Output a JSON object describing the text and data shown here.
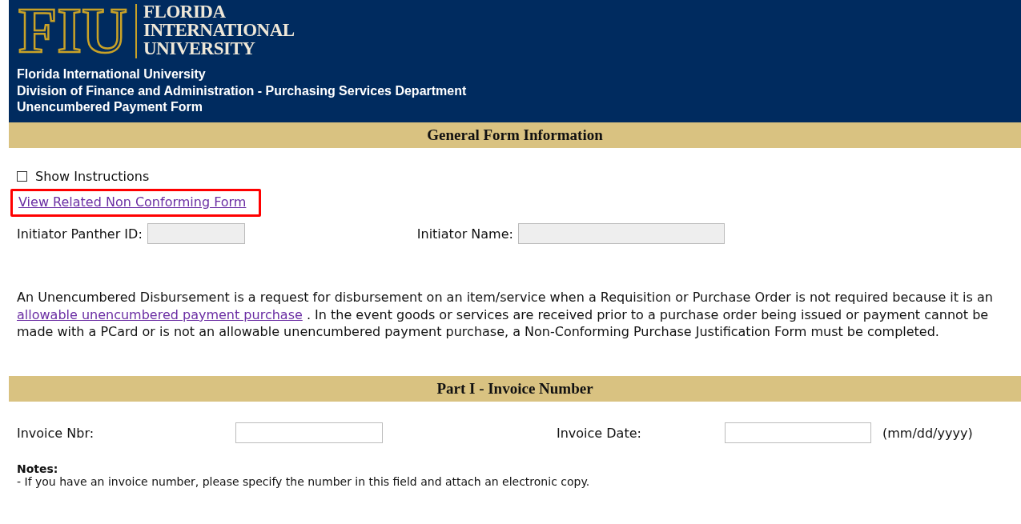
{
  "header": {
    "logo_letters": "FIU",
    "logo_name": [
      "FLORIDA",
      "INTERNATIONAL",
      "UNIVERSITY"
    ],
    "lines": [
      "Florida International University",
      "Division of Finance and Administration - Purchasing Services Department",
      "Unencumbered Payment Form"
    ]
  },
  "sections": [
    {
      "title": "General Form Information"
    },
    {
      "title": "Part I - Invoice Number"
    }
  ],
  "show_instructions": {
    "label": "Show Instructions",
    "checked": false
  },
  "related_link": {
    "label": "View Related Non Conforming Form",
    "highlighted": true
  },
  "initiator": [
    {
      "label": "Initiator Panther ID:",
      "disabled": true
    },
    {
      "label": "Initiator Name:",
      "disabled": true
    }
  ],
  "description": {
    "before": "An Unencumbered Disbursement is a request for disbursement on an item/service when a Requisition or Purchase Order is not required because it is an",
    "link": "allowable unencumbered payment purchase",
    "after": ". In the event goods or services are received prior to a purchase order being issued or payment cannot be made with a PCard or is not an allowable unencumbered payment purchase, a Non-Conforming Purchase Justification Form must be completed."
  },
  "invoice": [
    {
      "label": "Invoice Nbr:"
    },
    {
      "label": "Invoice Date:",
      "hint": "(mm/dd/yyyy)"
    }
  ],
  "notes": {
    "title": "Notes:",
    "items": [
      "- If you have an invoice number, please specify the number in this field and attach an electronic copy."
    ]
  }
}
